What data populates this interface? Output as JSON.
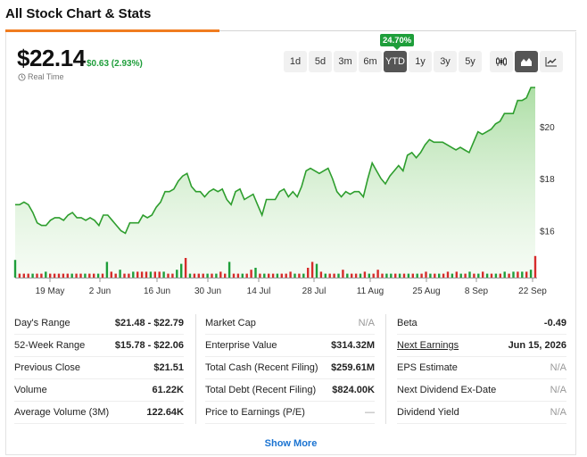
{
  "section": {
    "title": "All Stock Chart & Stats"
  },
  "quote": {
    "price": "$22.14",
    "change": "$0.63 (2.93%)",
    "realtime_label": "Real Time"
  },
  "ranges": {
    "badge": "24.70%",
    "items": [
      "1d",
      "5d",
      "3m",
      "6m",
      "YTD",
      "1y",
      "3y",
      "5y"
    ],
    "active": "YTD"
  },
  "chart_types": {
    "items": [
      "candlestick-icon",
      "area-chart-icon",
      "line-chart-icon"
    ],
    "active": "area-chart-icon"
  },
  "colors": {
    "accent": "#f07c20",
    "up": "#1e9e3a",
    "down": "#d62b2b",
    "link": "#1a73d1",
    "area_line": "#2e9e2e"
  },
  "chart_data": {
    "type": "area",
    "x_tick_labels": [
      "19 May",
      "2 Jun",
      "16 Jun",
      "30 Jun",
      "14 Jul",
      "28 Jul",
      "11 Aug",
      "25 Aug",
      "8 Sep",
      "22 Sep"
    ],
    "y_tick_labels": [
      "$16",
      "$18",
      "$20"
    ],
    "ylim": [
      14.2,
      21.5
    ],
    "grid": false,
    "series": [
      {
        "values": [
          17.0,
          17.0,
          17.1,
          17.0,
          16.7,
          16.3,
          16.2,
          16.2,
          16.4,
          16.5,
          16.5,
          16.4,
          16.6,
          16.7,
          16.5,
          16.5,
          16.4,
          16.5,
          16.4,
          16.2,
          16.6,
          16.6,
          16.4,
          16.2,
          16.0,
          15.9,
          16.3,
          16.3,
          16.3,
          16.6,
          16.5,
          16.6,
          16.9,
          17.1,
          17.5,
          17.5,
          17.6,
          17.9,
          18.1,
          18.2,
          17.7,
          17.5,
          17.5,
          17.3,
          17.5,
          17.6,
          17.5,
          17.6,
          17.2,
          17.0,
          17.5,
          17.6,
          17.2,
          17.3,
          17.4,
          17.0,
          16.6,
          17.2,
          17.2,
          17.2,
          17.5,
          17.6,
          17.3,
          17.5,
          17.3,
          17.7,
          18.3,
          18.4,
          18.3,
          18.2,
          18.3,
          18.4,
          18.0,
          17.5,
          17.3,
          17.5,
          17.4,
          17.5,
          17.5,
          17.3,
          18.0,
          18.6,
          18.3,
          18.0,
          17.8,
          18.1,
          18.3,
          18.5,
          18.3,
          18.9,
          19.0,
          18.8,
          19.0,
          19.3,
          19.5,
          19.4,
          19.4,
          19.4,
          19.3,
          19.2,
          19.1,
          19.2,
          19.1,
          19.0,
          19.4,
          19.8,
          19.7,
          19.8,
          19.9,
          20.1,
          20.2,
          20.5,
          20.5,
          20.5,
          21.0,
          21.0,
          21.1,
          21.5,
          21.5
        ]
      }
    ],
    "volume_colors": [
      "up",
      "down",
      "down",
      "down",
      "up",
      "down",
      "down",
      "up",
      "down",
      "down",
      "down",
      "down",
      "down",
      "up",
      "down",
      "down",
      "up",
      "down",
      "down",
      "up",
      "down",
      "up",
      "down",
      "down",
      "up",
      "down",
      "down",
      "up",
      "down",
      "down",
      "down",
      "up",
      "down",
      "down",
      "up",
      "down",
      "down",
      "up",
      "up",
      "down",
      "up",
      "down",
      "down",
      "down",
      "up",
      "down",
      "up",
      "down",
      "down",
      "up",
      "down",
      "down",
      "up",
      "down",
      "down",
      "up",
      "down",
      "up",
      "down",
      "down",
      "up",
      "down",
      "down",
      "down",
      "up",
      "down",
      "up",
      "down",
      "down",
      "up",
      "down",
      "up",
      "down",
      "down",
      "up",
      "down",
      "up",
      "down",
      "down",
      "up",
      "down",
      "up",
      "down",
      "down",
      "down",
      "up",
      "up",
      "down",
      "up",
      "down",
      "up",
      "down",
      "up",
      "down",
      "down",
      "up",
      "down",
      "up",
      "down",
      "down",
      "up",
      "down",
      "up",
      "down",
      "up",
      "down",
      "up",
      "down",
      "up",
      "down",
      "up",
      "down",
      "up",
      "down",
      "up",
      "down",
      "up",
      "down",
      "up"
    ],
    "volume_values": [
      9,
      2,
      2,
      2,
      2,
      2,
      2,
      3,
      2,
      2,
      2,
      2,
      2,
      2,
      2,
      2,
      2,
      2,
      2,
      2,
      2,
      8,
      3,
      2,
      4,
      2,
      2,
      3,
      3,
      3,
      3,
      3,
      3,
      3,
      3,
      2,
      2,
      4,
      7,
      10,
      2,
      2,
      2,
      2,
      2,
      2,
      2,
      3,
      2,
      8,
      2,
      2,
      2,
      2,
      4,
      5,
      2,
      2,
      2,
      2,
      2,
      2,
      2,
      3,
      2,
      2,
      2,
      5,
      8,
      7,
      3,
      2,
      2,
      2,
      2,
      4,
      2,
      2,
      2,
      2,
      3,
      2,
      2,
      4,
      2,
      2,
      2,
      2,
      2,
      2,
      2,
      2,
      2,
      2,
      3,
      2,
      2,
      2,
      2,
      3,
      2,
      3,
      2,
      2,
      3,
      2,
      2,
      3,
      2,
      2,
      2,
      2,
      3,
      2,
      3,
      3,
      3,
      3,
      4,
      11
    ]
  },
  "stats": {
    "col1": [
      {
        "label": "Day's Range",
        "value": "$21.48 - $22.79"
      },
      {
        "label": "52-Week Range",
        "value": "$15.78 - $22.06"
      },
      {
        "label": "Previous Close",
        "value": "$21.51"
      },
      {
        "label": "Volume",
        "value": "61.22K"
      },
      {
        "label": "Average Volume (3M)",
        "value": "122.64K"
      }
    ],
    "col2": [
      {
        "label": "Market Cap",
        "value": "N/A"
      },
      {
        "label": "Enterprise Value",
        "value": "$314.32M"
      },
      {
        "label": "Total Cash (Recent Filing)",
        "value": "$259.61M"
      },
      {
        "label": "Total Debt (Recent Filing)",
        "value": "$824.00K"
      },
      {
        "label": "Price to Earnings (P/E)",
        "value": "—"
      }
    ],
    "col3": [
      {
        "label": "Beta",
        "value": "-0.49"
      },
      {
        "label": "Next Earnings",
        "value": "Jun 15, 2026"
      },
      {
        "label": "EPS Estimate",
        "value": "N/A"
      },
      {
        "label": "Next Dividend Ex-Date",
        "value": "N/A"
      },
      {
        "label": "Dividend Yield",
        "value": "N/A"
      }
    ]
  },
  "show_more_label": "Show More"
}
